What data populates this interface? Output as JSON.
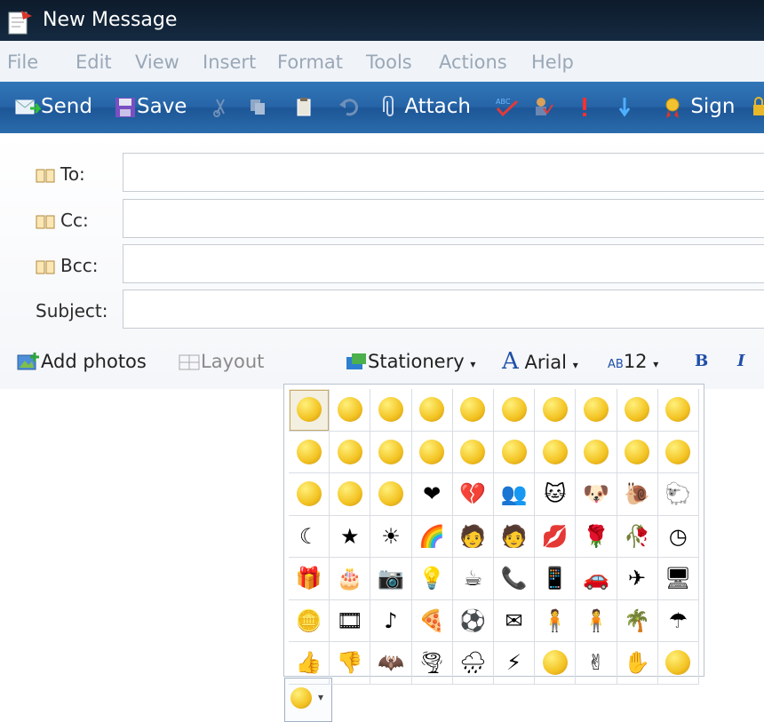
{
  "window": {
    "title": "New Message"
  },
  "menu": [
    "File",
    "Edit",
    "View",
    "Insert",
    "Format",
    "Tools",
    "Actions",
    "Help"
  ],
  "toolbar": {
    "send": "Send",
    "save": "Save",
    "attach": "Attach",
    "sign": "Sign"
  },
  "fields": {
    "to_label": "To:",
    "cc_label": "Cc:",
    "bcc_label": "Bcc:",
    "subject_label": "Subject:",
    "to_value": "",
    "cc_value": "",
    "bcc_value": "",
    "subject_value": ""
  },
  "format": {
    "add_photos": "Add photos",
    "layout": "Layout",
    "stationery": "Stationery",
    "font": "Arial",
    "size": "12",
    "bold": "B",
    "italic": "I"
  },
  "emoticons": [
    "smile",
    "grin",
    "surprised",
    "shocked",
    "tongue",
    "cool",
    "angry",
    "embarrassed",
    "confused",
    "sad",
    "crying",
    "wide-eyed",
    "nerd-teeth",
    "grimace",
    "glasses",
    "sick",
    "party",
    "sarcastic",
    "disappointed",
    "zipped",
    "dont-know",
    "eye-roll",
    "thinking",
    "heart",
    "broken-heart",
    "people",
    "cat",
    "dog",
    "snail",
    "sheep",
    "moon",
    "star",
    "sun",
    "rainbow",
    "hug-left",
    "hug-right",
    "lips",
    "rose",
    "wilted-rose",
    "clock",
    "gift",
    "cake",
    "camera",
    "lightbulb",
    "coffee",
    "phone",
    "mobile",
    "car",
    "airplane",
    "computer",
    "money",
    "film",
    "music",
    "pizza",
    "soccer-ball",
    "mail",
    "boy",
    "girl",
    "island",
    "umbrella",
    "thumbs-up",
    "thumbs-down",
    "bat",
    "storm",
    "rain",
    "lightning",
    "sleepy",
    "fingers-crossed",
    "high-five",
    "blush"
  ]
}
